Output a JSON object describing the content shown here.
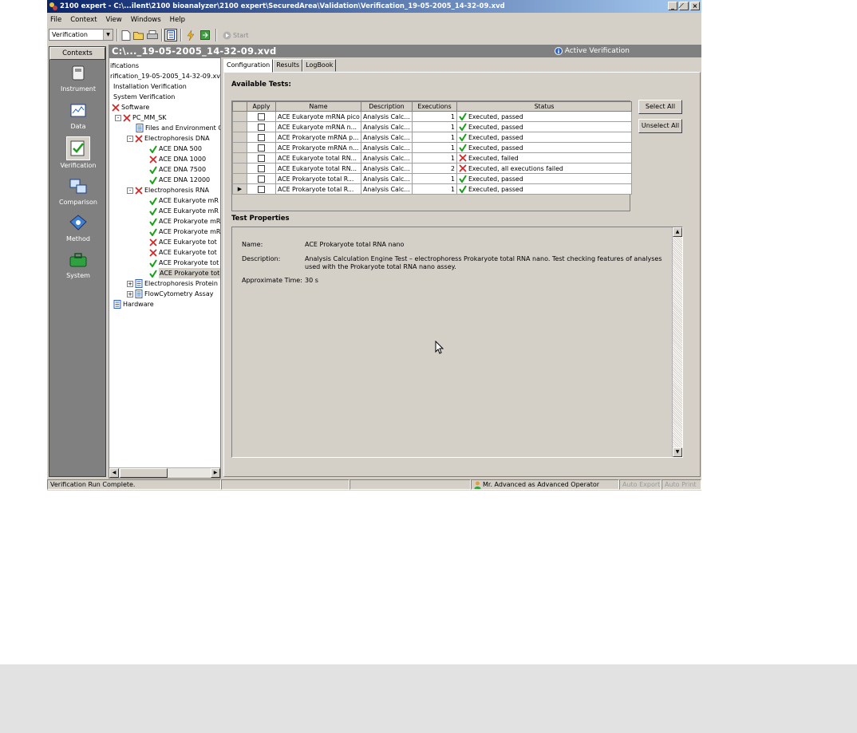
{
  "window": {
    "title": "2100 expert - C:\\...ilent\\2100 bioanalyzer\\2100 expert\\SecuredArea\\Validation\\Verification_19-05-2005_14-32-09.xvd",
    "minimize": "_",
    "maximize": "̸",
    "close": "×"
  },
  "menu": [
    "File",
    "Context",
    "View",
    "Windows",
    "Help"
  ],
  "toolbar": {
    "context_value": "Verification",
    "start_label": "Start"
  },
  "contexts": {
    "header": "Contexts",
    "items": [
      {
        "label": "Instrument",
        "icon": "instrument-icon"
      },
      {
        "label": "Data",
        "icon": "data-icon"
      },
      {
        "label": "Verification",
        "icon": "verification-icon",
        "selected": true
      },
      {
        "label": "Comparison",
        "icon": "comparison-icon"
      },
      {
        "label": "Method",
        "icon": "method-icon"
      },
      {
        "label": "System",
        "icon": "system-icon"
      }
    ]
  },
  "tree": {
    "items": [
      {
        "label": "ifications",
        "status": "none"
      },
      {
        "label": "rification_19-05-2005_14-32-09.xvd",
        "status": "none"
      },
      {
        "label": "Installation Verification",
        "status": "none"
      },
      {
        "label": "System Verification",
        "status": "none"
      },
      {
        "label": "Software",
        "status": "fail"
      },
      {
        "label": "PC_MM_SK",
        "status": "fail"
      },
      {
        "label": "Files and Environment C",
        "status": "doc"
      },
      {
        "label": "Electrophoresis DNA",
        "status": "fail"
      },
      {
        "label": "ACE DNA 500",
        "status": "pass"
      },
      {
        "label": "ACE DNA 1000",
        "status": "fail"
      },
      {
        "label": "ACE DNA 7500",
        "status": "pass"
      },
      {
        "label": "ACE DNA 12000",
        "status": "pass"
      },
      {
        "label": "Electrophoresis RNA",
        "status": "fail"
      },
      {
        "label": "ACE Eukaryote mR",
        "status": "pass"
      },
      {
        "label": "ACE Eukaryote mR",
        "status": "pass"
      },
      {
        "label": "ACE Prokaryote mR",
        "status": "pass"
      },
      {
        "label": "ACE Prokaryote mR",
        "status": "pass"
      },
      {
        "label": "ACE Eukaryote tot",
        "status": "fail"
      },
      {
        "label": "ACE Eukaryote tot",
        "status": "fail"
      },
      {
        "label": "ACE Prokaryote tot",
        "status": "pass"
      },
      {
        "label": "ACE Prokaryote tot",
        "status": "pass"
      },
      {
        "label": "Electrophoresis Protein",
        "status": "doc"
      },
      {
        "label": "FlowCytometry Assay",
        "status": "doc"
      },
      {
        "label": "Hardware",
        "status": "doc"
      }
    ]
  },
  "doc_header": {
    "title": "C:\\..._19-05-2005_14-32-09.xvd",
    "active": "Active Verification"
  },
  "tabs": [
    "Configuration",
    "Results",
    "LogBook"
  ],
  "available_tests": {
    "title": "Available Tests:",
    "columns": [
      "Apply",
      "Name",
      "Description",
      "Executions",
      "Status"
    ],
    "rows": [
      {
        "name": "ACE Eukaryote mRNA pico",
        "description": "Analysis Calc...",
        "executions": "1",
        "status": "Executed, passed",
        "result": "pass"
      },
      {
        "name": "ACE Eukaryote mRNA n...",
        "description": "Analysis Calc...",
        "executions": "1",
        "status": "Executed, passed",
        "result": "pass"
      },
      {
        "name": "ACE Prokaryote mRNA p...",
        "description": "Analysis Calc...",
        "executions": "1",
        "status": "Executed, passed",
        "result": "pass"
      },
      {
        "name": "ACE Prokaryote mRNA n...",
        "description": "Analysis Calc...",
        "executions": "1",
        "status": "Executed, passed",
        "result": "pass"
      },
      {
        "name": "ACE Eukaryote total RN...",
        "description": "Analysis Calc...",
        "executions": "1",
        "status": "Executed, failed",
        "result": "fail"
      },
      {
        "name": "ACE Eukaryote total RN...",
        "description": "Analysis Calc...",
        "executions": "2",
        "status": "Executed, all executions failed",
        "result": "fail"
      },
      {
        "name": "ACE Prokaryote total R...",
        "description": "Analysis Calc...",
        "executions": "1",
        "status": "Executed, passed",
        "result": "pass"
      },
      {
        "name": "ACE Prokaryote total R...",
        "description": "Analysis Calc...",
        "executions": "1",
        "status": "Executed, passed",
        "result": "pass"
      }
    ],
    "select_all": "Select All",
    "unselect_all": "Unselect All"
  },
  "test_properties": {
    "title": "Test Properties",
    "name_label": "Name:",
    "name_value": "ACE Prokaryote total RNA nano",
    "description_label": "Description:",
    "description_line1": "Analysis Calculation Engine Test – electrophoress Prokaryote total RNA nano. Test checking features of analyses",
    "description_line2": "used with the Prokaryote total RNA nano assey.",
    "time_label": "Approximate Time:",
    "time_value": "30 s"
  },
  "statusbar": {
    "message": "Verification Run Complete.",
    "user": "Mr. Advanced as Advanced Operator",
    "auto_export": "Auto Export",
    "auto_print": "Auto Print"
  },
  "colors": {
    "pass": "#18a018",
    "fail": "#d42020",
    "title_gradient_start": "#0a246a"
  }
}
